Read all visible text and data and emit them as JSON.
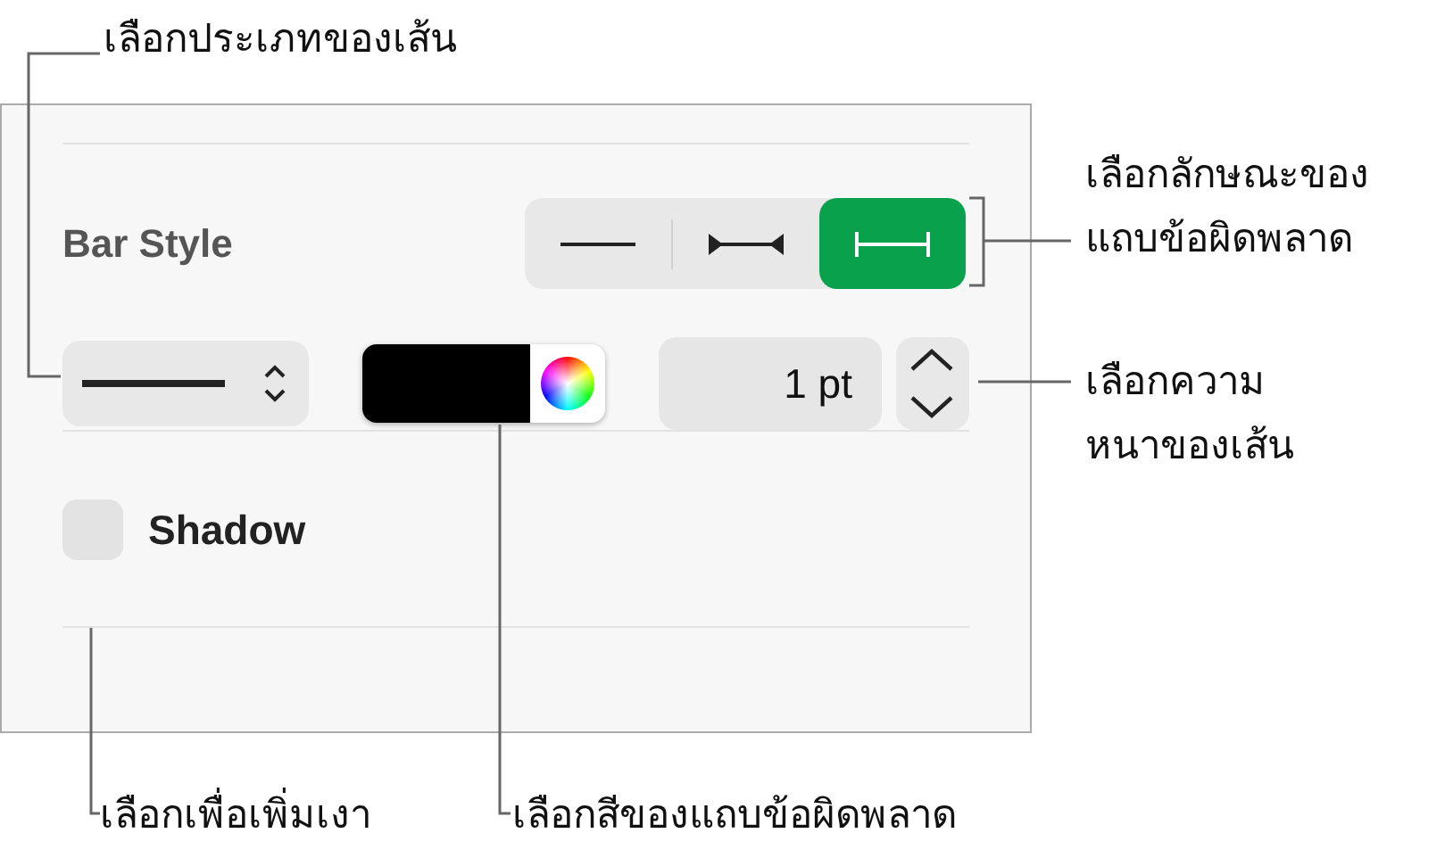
{
  "panel": {
    "title": "Bar Style",
    "segments": [
      {
        "kind": "plain",
        "selected": false
      },
      {
        "kind": "bowtie",
        "selected": false
      },
      {
        "kind": "ibeam",
        "selected": true
      }
    ],
    "color_well": {
      "color": "#000000"
    },
    "thickness": {
      "value": "1 pt"
    },
    "shadow": {
      "label": "Shadow",
      "checked": false
    }
  },
  "callouts": [
    {
      "lines": [
        "เลือกประเภทของเส้น"
      ]
    },
    {
      "lines": [
        "เลือกลักษณะของ",
        "แถบข้อผิดพลาด"
      ]
    },
    {
      "lines": [
        "เลือกความ",
        "หนาของเส้น"
      ]
    },
    {
      "lines": [
        "เลือกเพื่อเพิ่มเงา"
      ]
    },
    {
      "lines": [
        "เลือกสีของแถบข้อผิดพลาด"
      ]
    }
  ]
}
